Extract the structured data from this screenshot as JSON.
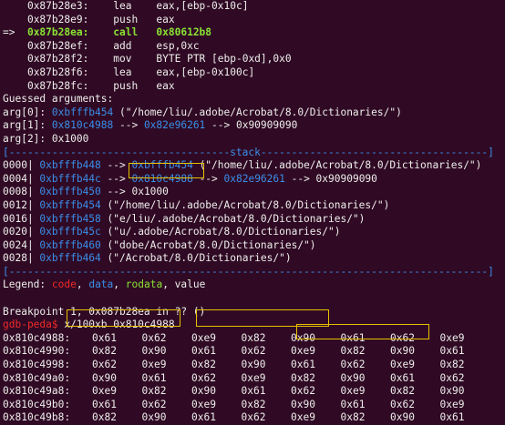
{
  "colors": {
    "background": "#300a24",
    "text": "#eeeeec",
    "address": "#3b8eea",
    "call": "#8ae234",
    "prompt": "#ef2929",
    "highlight_box": "#e5c000"
  },
  "disasm": [
    {
      "arrow": "",
      "addr": "0x87b28e3:",
      "op": "lea",
      "args": "eax,[ebp-0x10c]"
    },
    {
      "arrow": "",
      "addr": "0x87b28e9:",
      "op": "push",
      "args": "eax"
    },
    {
      "arrow": "=> ",
      "addr": "0x87b28ea:",
      "op": "call",
      "args": "0x80612b8"
    },
    {
      "arrow": "",
      "addr": "0x87b28ef:",
      "op": "add",
      "args": "esp,0xc"
    },
    {
      "arrow": "",
      "addr": "0x87b28f2:",
      "op": "mov",
      "args": "BYTE PTR [ebp-0xd],0x0"
    },
    {
      "arrow": "",
      "addr": "0x87b28f6:",
      "op": "lea",
      "args": "eax,[ebp-0x100c]"
    },
    {
      "arrow": "",
      "addr": "0x87b28fc:",
      "op": "push",
      "args": "eax"
    }
  ],
  "guessed": {
    "header": "Guessed arguments:",
    "args": [
      {
        "label": "arg[0]: ",
        "ptr": "0xbfffb454",
        "rest": " (\"/home/liu/.adobe/Acrobat/8.0/Dictionaries/\")"
      },
      {
        "label": "arg[1]: ",
        "ptr": "0x810c4988",
        "arrow": " --> ",
        "ptr2": "0x82e96261",
        "rest": " --> 0x90909090"
      },
      {
        "label": "arg[2]: ",
        "ptr": "",
        "rest": "0x1000"
      }
    ]
  },
  "stack_bar": "[------------------------------------stack-------------------------------------]",
  "end_bar": "[------------------------------------------------------------------------------]",
  "stack": [
    {
      "off": "0000|",
      "addr": "0xbfffb448",
      "a1": " --> ",
      "p1": "0xbfffb454",
      "rest": " (\"/home/liu/.adobe/Acrobat/8.0/Dictionaries/\")"
    },
    {
      "off": "0004|",
      "addr": "0xbfffb44c",
      "a1": " --> ",
      "p1": "0x810c4988",
      "a2": " --> ",
      "p2": "0x82e96261",
      "rest": " --> 0x90909090"
    },
    {
      "off": "0008|",
      "addr": "0xbfffb450",
      "a1": " --> ",
      "p1": "",
      "rest": "0x1000"
    },
    {
      "off": "0012|",
      "addr": "0xbfffb454",
      "rest": " (\"/home/liu/.adobe/Acrobat/8.0/Dictionaries/\")"
    },
    {
      "off": "0016|",
      "addr": "0xbfffb458",
      "rest": " (\"e/liu/.adobe/Acrobat/8.0/Dictionaries/\")"
    },
    {
      "off": "0020|",
      "addr": "0xbfffb45c",
      "rest": " (\"u/.adobe/Acrobat/8.0/Dictionaries/\")"
    },
    {
      "off": "0024|",
      "addr": "0xbfffb460",
      "rest": " (\"dobe/Acrobat/8.0/Dictionaries/\")"
    },
    {
      "off": "0028|",
      "addr": "0xbfffb464",
      "rest": " (\"/Acrobat/8.0/Dictionaries/\")"
    }
  ],
  "legend": {
    "prefix": "Legend: ",
    "code": "code",
    "data": "data",
    "rodata": "rodata",
    "value": "value"
  },
  "breakpoint": "Breakpoint 1, 0x087b28ea in ?? ()",
  "prompt": "gdb-peda$",
  "command": " x/100xb 0x810c4988",
  "hexdump": [
    {
      "addr": "0x810c4988:",
      "bytes": [
        "0x61",
        "0x62",
        "0xe9",
        "0x82",
        "0x90",
        "0x61",
        "0x62",
        "0xe9"
      ]
    },
    {
      "addr": "0x810c4990:",
      "bytes": [
        "0x82",
        "0x90",
        "0x61",
        "0x62",
        "0xe9",
        "0x82",
        "0x90",
        "0x61"
      ]
    },
    {
      "addr": "0x810c4998:",
      "bytes": [
        "0x62",
        "0xe9",
        "0x82",
        "0x90",
        "0x61",
        "0x62",
        "0xe9",
        "0x82"
      ]
    },
    {
      "addr": "0x810c49a0:",
      "bytes": [
        "0x90",
        "0x61",
        "0x62",
        "0xe9",
        "0x82",
        "0x90",
        "0x61",
        "0x62"
      ]
    },
    {
      "addr": "0x810c49a8:",
      "bytes": [
        "0xe9",
        "0x82",
        "0x90",
        "0x61",
        "0x62",
        "0xe9",
        "0x82",
        "0x90"
      ]
    },
    {
      "addr": "0x810c49b0:",
      "bytes": [
        "0x61",
        "0x62",
        "0xe9",
        "0x82",
        "0x90",
        "0x61",
        "0x62",
        "0xe9"
      ]
    },
    {
      "addr": "0x810c49b8:",
      "bytes": [
        "0x82",
        "0x90",
        "0x61",
        "0x62",
        "0xe9",
        "0x82",
        "0x90",
        "0x61"
      ]
    }
  ]
}
